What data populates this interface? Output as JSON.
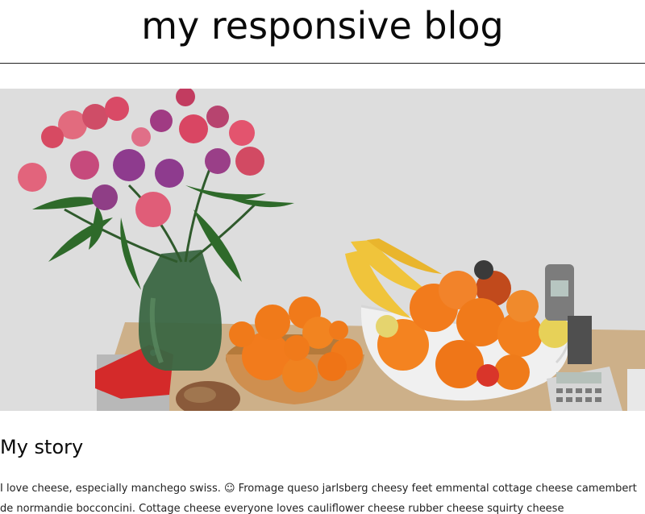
{
  "header": {
    "title": "my responsive blog"
  },
  "hero": {
    "description": "flowers-and-fruit-photo"
  },
  "story": {
    "heading": "My story",
    "text": "I love cheese, especially manchego swiss. ☺ Fromage queso jarlsberg cheesy feet emmental cottage cheese camembert de normandie bocconcini. Cottage cheese everyone loves cauliflower cheese rubber cheese squirty cheese"
  },
  "colors": {
    "wall": "#dcdcdc",
    "table": "#cfb48a",
    "orange": "#f07a1a",
    "banana": "#f0c23a",
    "flower_pink": "#d9446a",
    "flower_purple": "#8a3a8a",
    "vase_green": "#3f6b45",
    "bowl_white": "#e9e9e9",
    "wood_bowl": "#c98d4a"
  }
}
